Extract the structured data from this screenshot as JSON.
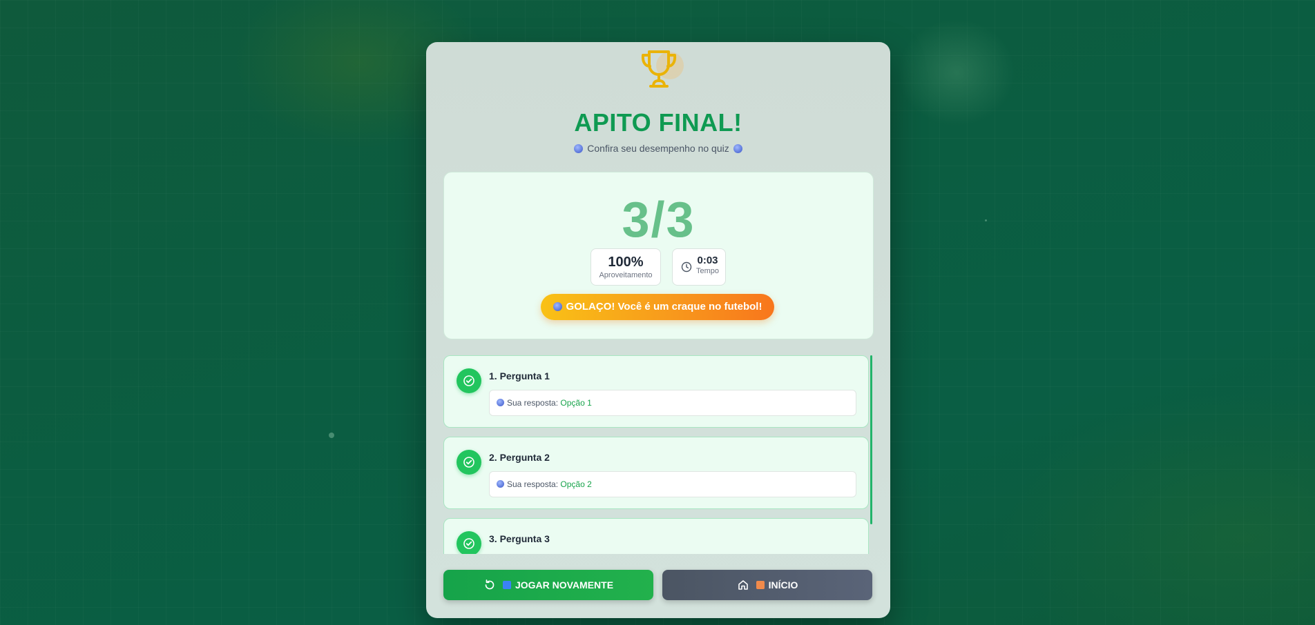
{
  "result": {
    "title": "APITO FINAL!",
    "subtitle": "Confira seu desempenho no quiz",
    "score": "3/3",
    "percentage": "100%",
    "percentage_label": "Aproveitamento",
    "time": "0:03",
    "time_label": "Tempo",
    "message": "GOLAÇO! Você é um craque no futebol!"
  },
  "answers_prefix": "Sua resposta:",
  "questions": [
    {
      "title": "1. Pergunta 1",
      "answer": "Opção 1",
      "correct": true
    },
    {
      "title": "2. Pergunta 2",
      "answer": "Opção 2",
      "correct": true
    },
    {
      "title": "3. Pergunta 3",
      "answer": "",
      "correct": true
    }
  ],
  "actions": {
    "replay_label": "JOGAR NOVAMENTE",
    "home_label": "INÍCIO"
  },
  "colors": {
    "accent": "#0f9a52",
    "correct": "#22c55e",
    "badge_start": "#f9c116",
    "badge_end": "#f8761c",
    "home_button": "#4b5563"
  },
  "icons": [
    "trophy-icon",
    "globe-icon",
    "clock-icon",
    "check-circle-icon",
    "refresh-icon",
    "home-icon"
  ]
}
